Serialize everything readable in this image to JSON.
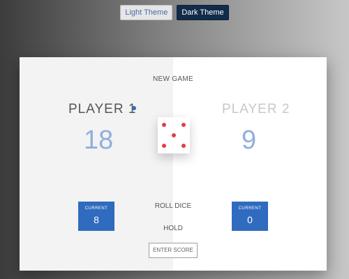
{
  "theme": {
    "light_label": "Light Theme",
    "dark_label": "Dark Theme"
  },
  "game": {
    "new_game_label": "NEW GAME",
    "roll_label": "ROLL DICE",
    "hold_label": "HOLD",
    "enter_score_label": "ENTER SCORE"
  },
  "players": [
    {
      "name": "PLAYER 1",
      "score": "18",
      "current_label": "CURRENT",
      "current": "8",
      "active": true
    },
    {
      "name": "PLAYER 2",
      "score": "9",
      "current_label": "CURRENT",
      "current": "0",
      "active": false
    }
  ],
  "dice": {
    "value": 5,
    "pip_color": "#e14040"
  },
  "colors": {
    "accent": "#2f6bbf",
    "dark_button": "#112c4a",
    "score_color": "#8fb0dc"
  }
}
